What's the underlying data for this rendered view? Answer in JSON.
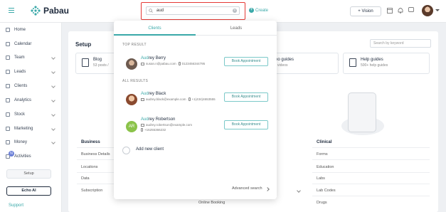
{
  "brand": {
    "name": "Pabau",
    "accent": "#3aa9a9"
  },
  "search": {
    "value": "aud"
  },
  "header": {
    "create_label": "Create",
    "vision_label": "+ Vision"
  },
  "sidebar": {
    "items": [
      {
        "label": "Home",
        "icon": "home-icon"
      },
      {
        "label": "Calendar",
        "icon": "calendar-icon"
      },
      {
        "label": "Team",
        "icon": "team-icon"
      },
      {
        "label": "Leads",
        "icon": "leads-icon"
      },
      {
        "label": "Clients",
        "icon": "clients-icon"
      },
      {
        "label": "Analytics",
        "icon": "analytics-icon"
      },
      {
        "label": "Stock",
        "icon": "stock-icon"
      },
      {
        "label": "Marketing",
        "icon": "marketing-icon"
      },
      {
        "label": "Money",
        "icon": "money-icon"
      },
      {
        "label": "Activities",
        "icon": "activities-icon"
      }
    ],
    "setup_label": "Setup",
    "echo_label": "Echo AI",
    "support_label": "Support"
  },
  "main": {
    "title": "Setup",
    "keyword_placeholder": "Search by keyword",
    "cards": [
      {
        "title": "Blog",
        "sub": "53 posts /"
      },
      {
        "title": "eo guides",
        "sub": "r videos"
      },
      {
        "title": "Help guides",
        "sub": "500+ help guides"
      }
    ],
    "business": {
      "header": "Business",
      "items": [
        "Business Details",
        "Locations",
        "Data",
        "Subscription"
      ]
    },
    "clinical": {
      "header": "Clinical",
      "items": [
        "Forms",
        "Education",
        "Labs",
        "Lab Codes",
        "Drugs"
      ]
    },
    "online_booking": "Online Booking"
  },
  "dropdown": {
    "tabs": [
      "Clients",
      "Leads"
    ],
    "top_result_label": "TOP RESULT",
    "all_results_label": "ALL RESULTS",
    "book_label": "Book Appointment",
    "top_result": {
      "name_hl": "Aud",
      "name_rest": "rey Berry",
      "email": "susan.n@pabau.com",
      "phone": "0123456344795"
    },
    "results": [
      {
        "name_hl": "Aud",
        "name_rest": "rey Black",
        "email": "audrey.black@example.com",
        "phone": "+1(434)4653555"
      },
      {
        "name_hl": "Aud",
        "name_rest": "rey Robertson",
        "email": "audrey.robertson@example.com",
        "phone": "+16255366232",
        "initials": "AR"
      }
    ],
    "add_new_label": "Add new client",
    "advanced_label": "Advanced search"
  }
}
